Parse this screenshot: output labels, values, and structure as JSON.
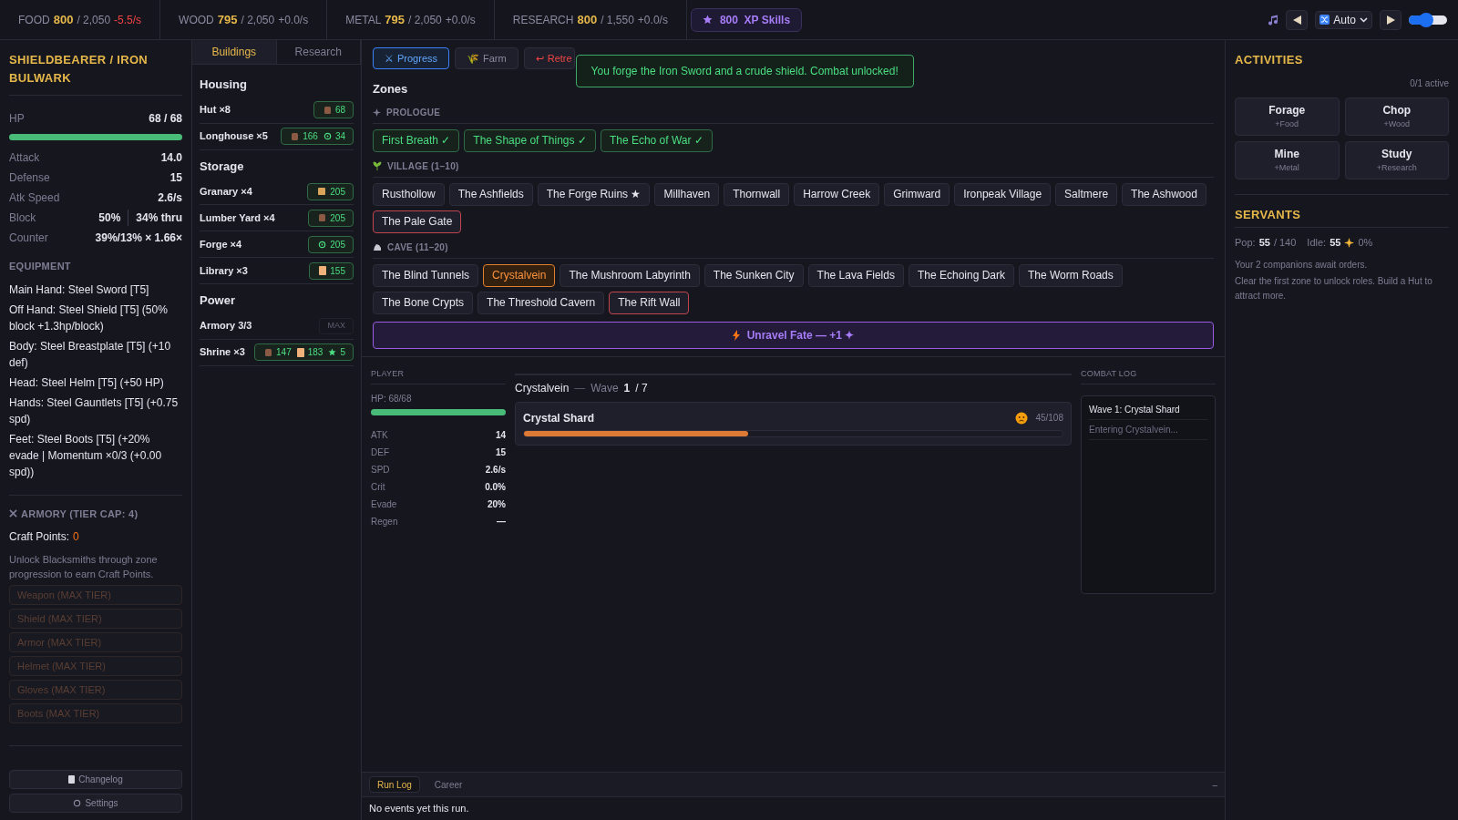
{
  "resources": [
    {
      "label": "FOOD",
      "value": "800",
      "cap": "/ 2,050",
      "rate": "-5.5/s",
      "kind": "negative"
    },
    {
      "label": "WOOD",
      "value": "795",
      "cap": "/ 2,050",
      "rate": "+0.0/s",
      "kind": "neutral"
    },
    {
      "label": "METAL",
      "value": "795",
      "cap": "/ 2,050",
      "rate": "+0.0/s",
      "kind": "neutral"
    },
    {
      "label": "RESEARCH",
      "value": "800",
      "cap": "/ 1,550",
      "rate": "+0.0/s",
      "kind": "neutral"
    }
  ],
  "xp_button": {
    "value": "800",
    "label": "XP Skills"
  },
  "music": {
    "mode": "Auto",
    "volume": {
      "level": 0.45
    }
  },
  "character": {
    "title": "SHIELDBEARER / IRON BULWARK",
    "hp_label": "HP",
    "hp": "68 / 68",
    "hp_bar": {
      "level": 1
    },
    "stats": [
      {
        "label": "Attack",
        "value": "14.0"
      },
      {
        "label": "Defense",
        "value": "15"
      },
      {
        "label": "Atk Speed",
        "value": "2.6/s"
      },
      {
        "label": "Block",
        "value": "50%",
        "extra": "34% thru"
      },
      {
        "label": "Counter",
        "value": "39%/13% × 1.66×"
      }
    ],
    "equipment_heading": "EQUIPMENT",
    "equipment": [
      "Main Hand: Steel Sword [T5]",
      "Off Hand: Steel Shield [T5] (50% block +1.3hp/block)",
      "Body: Steel Breastplate [T5] (+10 def)",
      "Head: Steel Helm [T5] (+50 HP)",
      "Hands: Steel Gauntlets [T5] (+0.75 spd)",
      "Feet: Steel Boots [T5] (+20% evade | Momentum ×0/3 (+0.00 spd))"
    ]
  },
  "armory": {
    "heading": "ARMORY (TIER CAP: 4)",
    "craft_label": "Craft Points:",
    "craft_points": "0",
    "note": "Unlock Blacksmiths through zone progression to earn Craft Points.",
    "buttons": [
      {
        "label": "Weapon (MAX TIER)",
        "disabled": true
      },
      {
        "label": "Shield (MAX TIER)",
        "disabled": true
      },
      {
        "label": "Armor (MAX TIER)",
        "disabled": true
      },
      {
        "label": "Helmet (MAX TIER)",
        "disabled": true
      },
      {
        "label": "Gloves (MAX TIER)",
        "disabled": true
      },
      {
        "label": "Boots (MAX TIER)",
        "disabled": true
      }
    ]
  },
  "footer_buttons": [
    {
      "label": "Changelog",
      "kind": "changelog"
    },
    {
      "label": "Settings",
      "kind": "settings"
    }
  ],
  "building_tabs": [
    {
      "label": "Buildings",
      "selected": true
    },
    {
      "label": "Research",
      "selected": false
    }
  ],
  "building_groups": [
    {
      "name": "Housing",
      "items": [
        {
          "name": "Hut ×8",
          "maxed": false,
          "costs": [
            {
              "kind": "wood",
              "value": "68"
            }
          ]
        },
        {
          "name": "Longhouse ×5",
          "maxed": false,
          "costs": [
            {
              "kind": "wood",
              "value": "166"
            },
            {
              "kind": "metal",
              "value": "34"
            }
          ]
        }
      ]
    },
    {
      "name": "Storage",
      "items": [
        {
          "name": "Granary ×4",
          "maxed": false,
          "costs": [
            {
              "kind": "food",
              "value": "205"
            }
          ]
        },
        {
          "name": "Lumber Yard ×4",
          "maxed": false,
          "costs": [
            {
              "kind": "wood",
              "value": "205"
            }
          ]
        },
        {
          "name": "Forge ×4",
          "maxed": false,
          "costs": [
            {
              "kind": "metal",
              "value": "205"
            }
          ]
        },
        {
          "name": "Library ×3",
          "maxed": false,
          "costs": [
            {
              "kind": "research",
              "value": "155"
            }
          ]
        }
      ]
    },
    {
      "name": "Power",
      "items": [
        {
          "name": "Armory 3/3",
          "maxed": true,
          "max_label": "MAX"
        },
        {
          "name": "Shrine ×3",
          "maxed": false,
          "costs": [
            {
              "kind": "wood",
              "value": "147"
            },
            {
              "kind": "research",
              "value": "183"
            },
            {
              "kind": "xp",
              "value": "5"
            }
          ]
        }
      ]
    }
  ],
  "mode_tabs": [
    {
      "label": "Progress",
      "icon": "⚔",
      "kind": "progress",
      "selected": true
    },
    {
      "label": "Farm",
      "icon": "🌾",
      "kind": "farm",
      "selected": false
    },
    {
      "label": "Retre",
      "icon": "↩",
      "kind": "retreat",
      "selected": false
    }
  ],
  "toast": "You forge the Iron Sword and a crude shield. Combat unlocked!",
  "zones_heading": "Zones",
  "zone_groups": [
    {
      "name": "PROLOGUE",
      "kind": "prologue",
      "zones": [
        {
          "name": "First Breath ✓",
          "kind": "cleared",
          "selected": false
        },
        {
          "name": "The Shape of Things ✓",
          "kind": "cleared",
          "selected": false
        },
        {
          "name": "The Echo of War ✓",
          "kind": "cleared",
          "selected": false
        }
      ]
    },
    {
      "name": "VILLAGE (1–10)",
      "kind": "village",
      "zones": [
        {
          "name": "Rusthollow",
          "kind": "normal",
          "selected": false
        },
        {
          "name": "The Ashfields",
          "kind": "normal",
          "selected": false
        },
        {
          "name": "The Forge Ruins ★",
          "kind": "normal",
          "selected": false
        },
        {
          "name": "Millhaven",
          "kind": "normal",
          "selected": false
        },
        {
          "name": "Thornwall",
          "kind": "normal",
          "selected": false
        },
        {
          "name": "Harrow Creek",
          "kind": "normal",
          "selected": false
        },
        {
          "name": "Grimward",
          "kind": "normal",
          "selected": false
        },
        {
          "name": "Ironpeak Village",
          "kind": "normal",
          "selected": false
        },
        {
          "name": "Saltmere",
          "kind": "normal",
          "selected": false
        },
        {
          "name": "The Ashwood",
          "kind": "normal",
          "selected": false
        },
        {
          "name": "The Pale Gate",
          "kind": "boss",
          "selected": false
        }
      ]
    },
    {
      "name": "CAVE (11–20)",
      "kind": "cave",
      "zones": [
        {
          "name": "The Blind Tunnels",
          "kind": "normal",
          "selected": false
        },
        {
          "name": "Crystalvein",
          "kind": "normal",
          "selected": true
        },
        {
          "name": "The Mushroom Labyrinth",
          "kind": "normal",
          "selected": false
        },
        {
          "name": "The Sunken City",
          "kind": "normal",
          "selected": false
        },
        {
          "name": "The Lava Fields",
          "kind": "normal",
          "selected": false
        },
        {
          "name": "The Echoing Dark",
          "kind": "normal",
          "selected": false
        },
        {
          "name": "The Worm Roads",
          "kind": "normal",
          "selected": false
        },
        {
          "name": "The Bone Crypts",
          "kind": "normal",
          "selected": false
        },
        {
          "name": "The Threshold Cavern",
          "kind": "normal",
          "selected": false
        },
        {
          "name": "The Rift Wall",
          "kind": "boss",
          "selected": false
        }
      ]
    }
  ],
  "unravel_button": "Unravel Fate — +1 ✦",
  "player": {
    "heading": "PLAYER",
    "hp": "HP: 68/68",
    "hp_bar": {
      "level": 1
    },
    "stats": [
      {
        "label": "ATK",
        "value": "14"
      },
      {
        "label": "DEF",
        "value": "15"
      },
      {
        "label": "SPD",
        "value": "2.6/s"
      },
      {
        "label": "Crit",
        "value": "0.0%"
      },
      {
        "label": "Evade",
        "value": "20%"
      },
      {
        "label": "Regen",
        "value": "—"
      }
    ]
  },
  "battle": {
    "zone": "Crystalvein",
    "separator": "—",
    "wave_label": "Wave",
    "wave": "1",
    "wave_total": "/ 7",
    "enemy": {
      "name": "Crystal Shard",
      "hp": "45/108",
      "level": 0.417
    }
  },
  "combat_log": {
    "heading": "COMBAT LOG",
    "entries": [
      {
        "text": "Wave 1: Crystal Shard",
        "kind": "title"
      },
      {
        "text": "Entering Crystalvein...",
        "kind": "info"
      }
    ]
  },
  "log_tabs": [
    {
      "label": "Run Log",
      "selected": true
    },
    {
      "label": "Career",
      "selected": false
    }
  ],
  "log_collapse": "–",
  "run_log": "No events yet this run.",
  "activities": {
    "heading": "ACTIVITIES",
    "count": "0/1 active",
    "items": [
      {
        "name": "Forage",
        "yield": "+Food"
      },
      {
        "name": "Chop",
        "yield": "+Wood"
      },
      {
        "name": "Mine",
        "yield": "+Metal"
      },
      {
        "name": "Study",
        "yield": "+Research"
      }
    ]
  },
  "servants": {
    "heading": "SERVANTS",
    "pop_label": "Pop:",
    "pop": "55",
    "pop_cap": "/ 140",
    "idle_label": "Idle:",
    "idle": "55",
    "bonus": "0%",
    "lines": [
      "Your 2 companions await orders.",
      "Clear the first zone to unlock roles. Build a Hut to attract more."
    ]
  }
}
